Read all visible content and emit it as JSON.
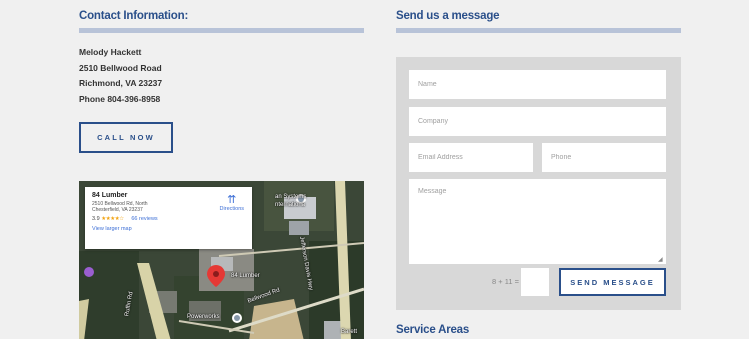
{
  "contact": {
    "title": "Contact Information:",
    "name": "Melody Hackett",
    "street": "2510 Bellwood Road",
    "city": "Richmond, VA 23237",
    "phone": "Phone 804-396-8958",
    "call_label": "CALL NOW"
  },
  "map": {
    "place_name": "84 Lumber",
    "address_line1": "2510 Bellwood Rd, North",
    "address_line2": "Chesterfield, VA 23237",
    "rating": "3.9",
    "stars": "★★★★☆",
    "reviews": "66 reviews",
    "larger_map": "View larger map",
    "directions": "Directions",
    "labels": {
      "lumber": "84 Lumber",
      "bellwood": "Bellwood Rd",
      "systems": "an Systems",
      "international": "nternationa",
      "parkway": "Jefferson Davis Hwy",
      "pelham": "Ruffin Rd",
      "powerworks": "Powerworks",
      "baretti": "Barett"
    }
  },
  "message": {
    "title": "Send us a message",
    "name_placeholder": "Name",
    "company_placeholder": "Company",
    "email_placeholder": "Email Address",
    "phone_placeholder": "Phone",
    "message_placeholder": "Message",
    "captcha": "8 + 11 =",
    "send_label": "SEND MESSAGE"
  },
  "service": {
    "title": "Service Areas"
  },
  "colors": {
    "accent": "#2a4f8a",
    "bar": "#b8c3d8",
    "form_bg": "#d8d8d8",
    "page_bg": "#f0f0f0"
  }
}
